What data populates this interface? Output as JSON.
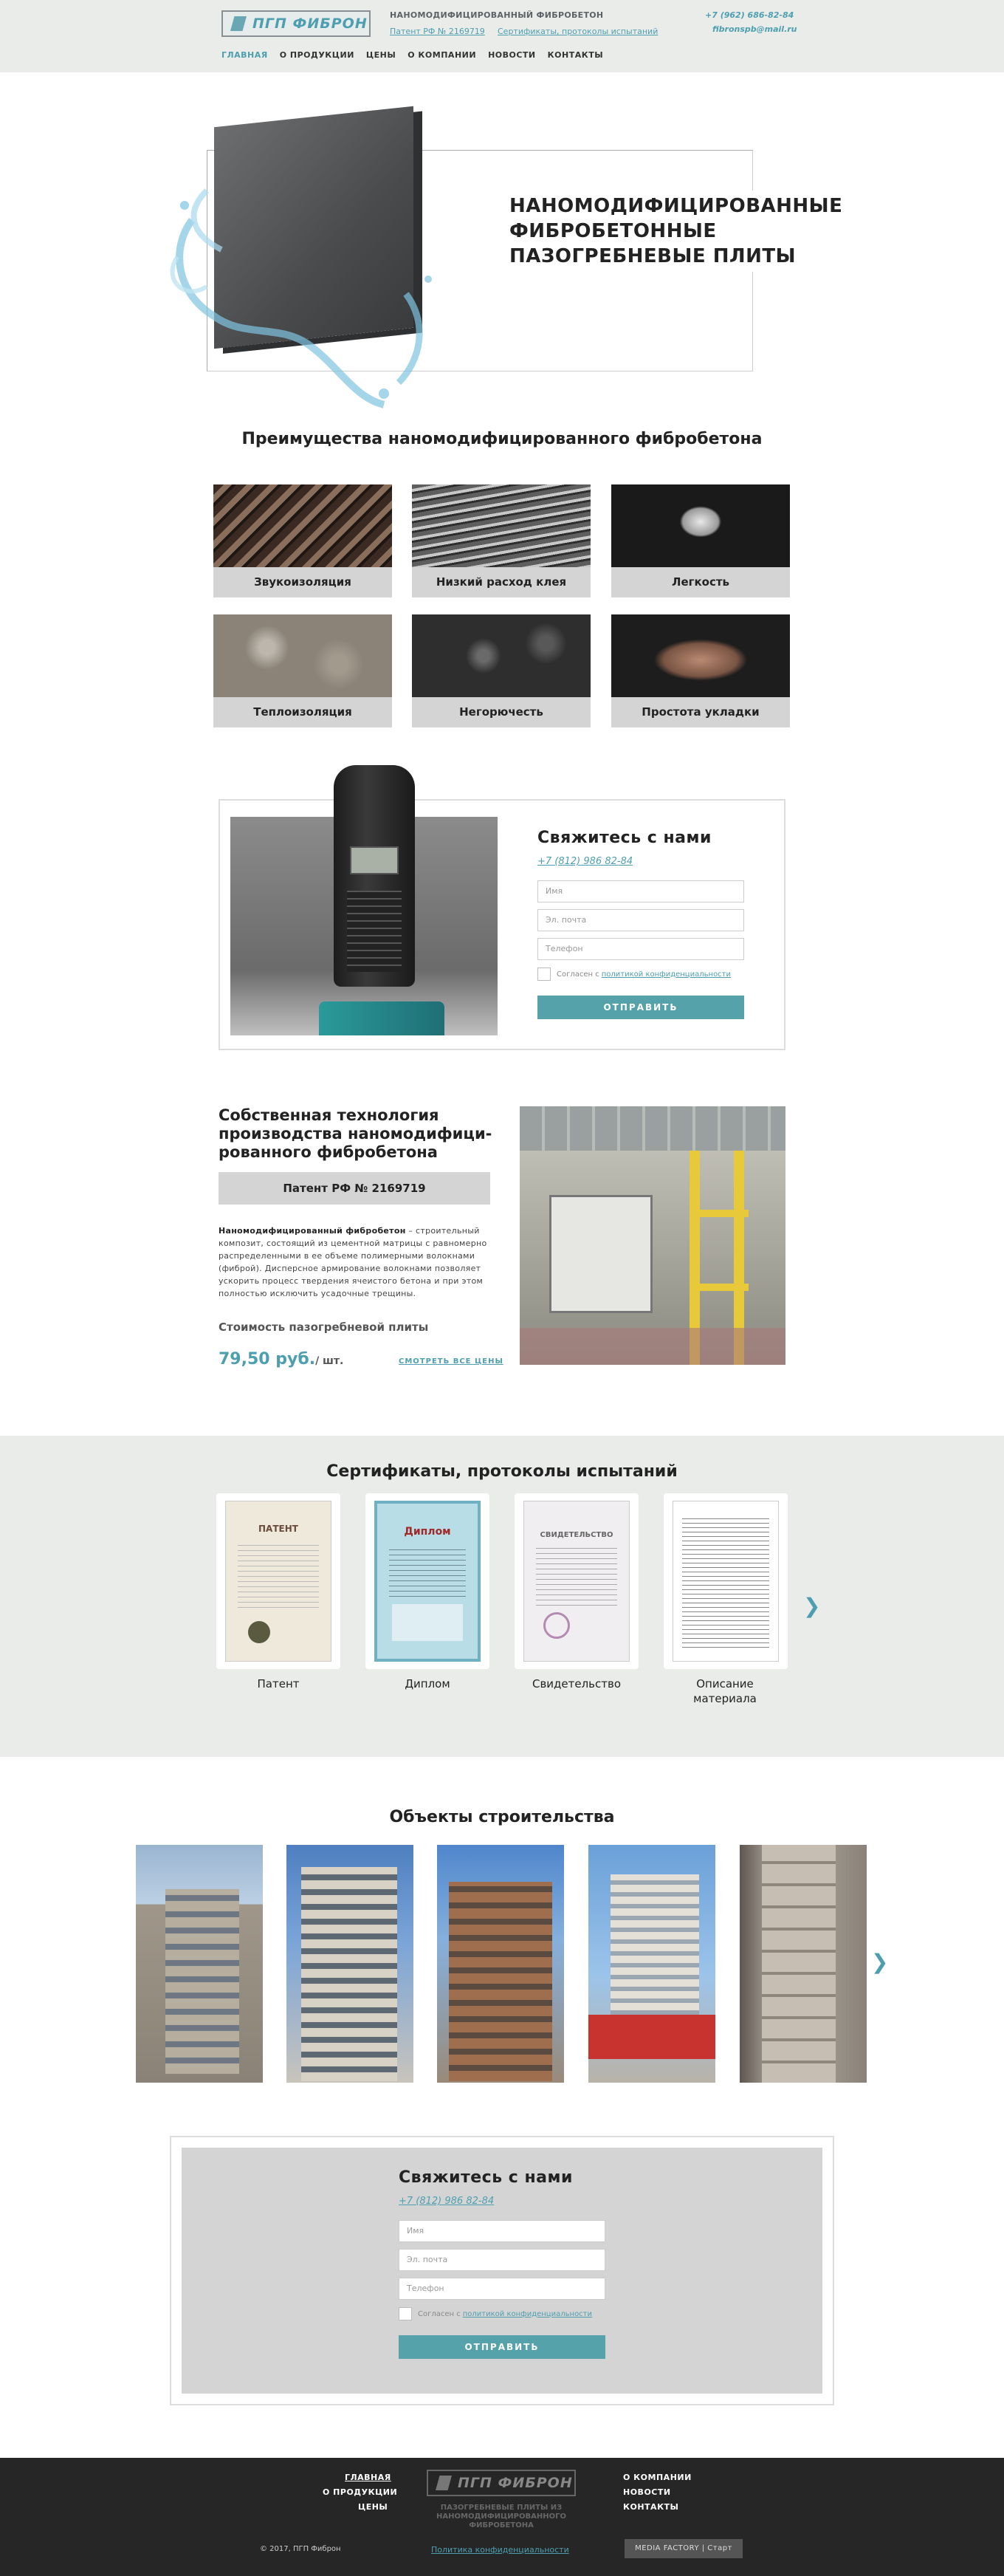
{
  "header": {
    "logo_text": "ПГП ФИБРОН",
    "title": "НАНОМОДИФИЦИРОВАННЫЙ ФИБРОБЕТОН",
    "patent_link": "Патент РФ № 2169719",
    "certs_link": "Сертификаты, протоколы испытаний",
    "phone": "+7 (962) 686-82-84",
    "email": "fibronspb@mail.ru",
    "nav": [
      "ГЛАВНАЯ",
      "О ПРОДУКЦИИ",
      "ЦЕНЫ",
      "О КОМПАНИИ",
      "НОВОСТИ",
      "КОНТАКТЫ"
    ]
  },
  "hero": {
    "title": "НАНОМОДИФИЦИРОВАННЫЕ ФИБРОБЕТОННЫЕ ПАЗОГРЕБНЕВЫЕ ПЛИТЫ"
  },
  "advantages": {
    "title": "Преимущества наномодифицированного фибробетона",
    "items": [
      "Звукоизоляция",
      "Низкий расход клея",
      "Легкость",
      "Теплоизоляция",
      "Негорючесть",
      "Простота укладки"
    ]
  },
  "contact_form": {
    "title": "Свяжитесь с нами",
    "phone": "+7 (812) 986 82-84",
    "name_placeholder": "Имя",
    "email_placeholder": "Эл. почта",
    "phone_placeholder": "Телефон",
    "consent_text": "Согласен с",
    "consent_link": "политикой конфиденциальности",
    "submit": "ОТПРАВИТЬ"
  },
  "technology": {
    "title": "Собственная технология производства наномодифици- рованного фибробетона",
    "patent": "Патент РФ № 2169719",
    "text_bold": "Наномодифицированный фибробетон",
    "text": " – строительный композит, состоящий из цементной матрицы с равномерно распределенными в ее объеме полимерными волокнами (фиброй). Дисперсное армирование волокнами позволяет ускорить процесс твердения ячеистого бетона и при этом полностью исключить усадочные трещины.",
    "price_label": "Стоимость пазогребневой плиты",
    "price": "79,50 руб.",
    "price_unit": "/ шт.",
    "price_link": "СМОТРЕТЬ ВСЕ ЦЕНЫ"
  },
  "certificates": {
    "title": "Сертификаты, протоколы испытаний",
    "items": [
      "Патент",
      "Диплом",
      "Свидетельство",
      "Описание материала"
    ],
    "doc_titles": [
      "ПАТЕНТ",
      "Диплом",
      "СВИДЕТЕЛЬСТВО"
    ]
  },
  "objects": {
    "title": "Объекты строительства"
  },
  "footer": {
    "nav_left": [
      "ГЛАВНАЯ",
      "О ПРОДУКЦИИ",
      "ЦЕНЫ"
    ],
    "nav_right": [
      "О КОМПАНИИ",
      "НОВОСТИ",
      "КОНТАКТЫ"
    ],
    "logo_text": "ПГП ФИБРОН",
    "tagline": "ПАЗОГРЕБНЕВЫЕ ПЛИТЫ ИЗ НАНОМОДИФИЦИРОВАННОГО ФИБРОБЕТОНА",
    "copyright": "© 2017, ПГП Фиброн",
    "policy": "Политика конфиденциальности",
    "badge": "MEDIA FACTORY | Старт"
  },
  "colors": {
    "accent": "#4d9fb0",
    "button": "#55a2ab",
    "header_bg": "#eaecea",
    "caption_bg": "#d4d4d4",
    "footer_bg": "#262626"
  }
}
